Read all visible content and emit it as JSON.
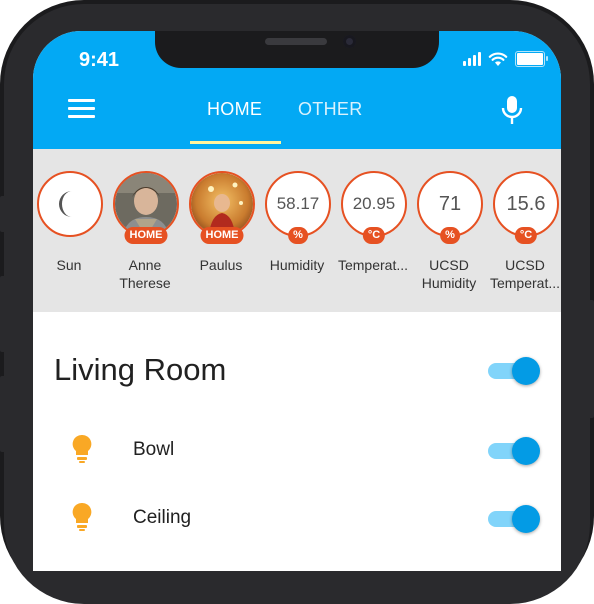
{
  "status": {
    "time": "9:41",
    "battery_level": 1.0
  },
  "appbar": {
    "tabs": [
      {
        "label": "HOME",
        "active": true
      },
      {
        "label": "OTHER",
        "active": false
      }
    ],
    "accent_color": "#03a9f4",
    "indicator_color": "#fff59d"
  },
  "badges": [
    {
      "icon": "moon-icon",
      "label_lines": [
        "Sun"
      ]
    },
    {
      "icon": "person-photo",
      "tag": "HOME",
      "label_lines": [
        "Anne",
        "Therese"
      ]
    },
    {
      "icon": "person-photo",
      "tag": "HOME",
      "label_lines": [
        "Paulus"
      ]
    },
    {
      "value": "58.17",
      "tag": "%",
      "label_lines": [
        "Humidity"
      ]
    },
    {
      "value": "20.95",
      "tag": "°C",
      "label_lines": [
        "Temperat..."
      ]
    },
    {
      "value": "71",
      "tag": "%",
      "label_lines": [
        "UCSD",
        "Humidity"
      ]
    },
    {
      "value": "15.6",
      "tag": "°C",
      "label_lines": [
        "UCSD",
        "Temperat..."
      ]
    }
  ],
  "badge_color": "#e65122",
  "room": {
    "title": "Living Room",
    "toggle_on": true,
    "entities": [
      {
        "name": "Bowl",
        "icon": "lightbulb-icon",
        "on": true
      },
      {
        "name": "Ceiling",
        "icon": "lightbulb-icon",
        "on": true
      }
    ]
  }
}
